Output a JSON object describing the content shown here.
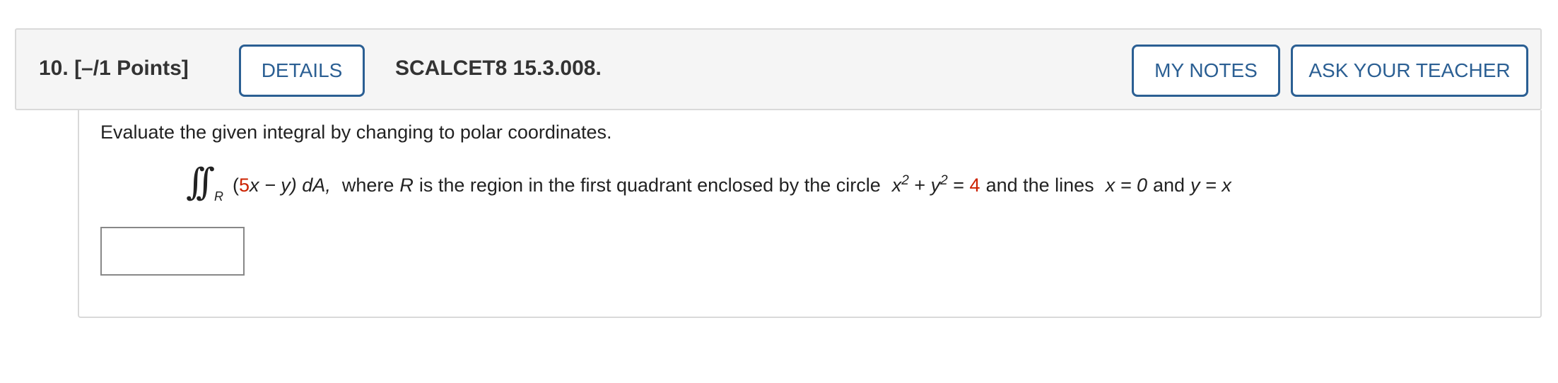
{
  "question": {
    "number_label": "10.",
    "points_label": "[–/1 Points]",
    "details_button": "DETAILS",
    "source": "SCALCET8 15.3.008.",
    "my_notes_button": "MY NOTES",
    "ask_teacher_button": "ASK YOUR TEACHER"
  },
  "problem": {
    "instruction": "Evaluate the given integral by changing to polar coordinates.",
    "integral_region": "R",
    "integrand_open": "(",
    "integrand_coef": "5",
    "integrand_rest": "x − y) dA,",
    "text_where": "where",
    "text_R": "R",
    "text_region": "is the region in the first quadrant enclosed by the circle",
    "circle_x": "x",
    "circle_plus": "+",
    "circle_y": "y",
    "exponent": "2",
    "equals": "=",
    "radius_sq": "4",
    "text_lines": "and the lines",
    "line1": "x = 0",
    "text_and": "and",
    "line2": "y = x"
  },
  "answer": {
    "value": "",
    "placeholder": ""
  },
  "colors": {
    "button_blue": "#2b5f93",
    "highlight_red": "#cc2200",
    "header_bg": "#f5f5f5"
  }
}
